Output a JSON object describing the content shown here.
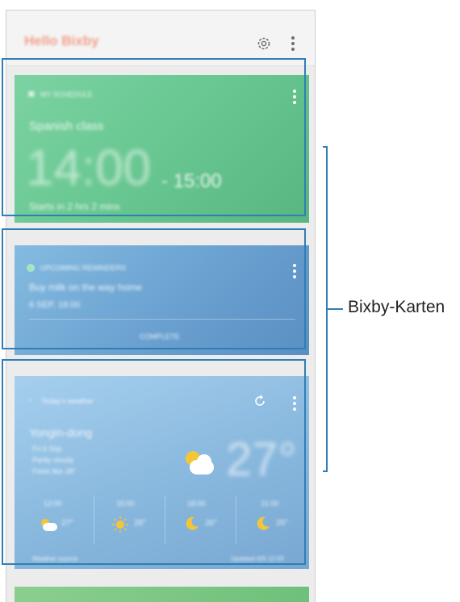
{
  "header": {
    "title": "Hello Bixby",
    "settings_icon": "gear-icon",
    "more_icon": "more-vertical-icon"
  },
  "cards": {
    "schedule": {
      "label": "MY SCHEDULE",
      "event": "Spanish class",
      "start_time": "14:00",
      "end_time": "- 15:00",
      "status": "Starts in 2 hrs 2 mins"
    },
    "reminder": {
      "label": "UPCOMING REMINDERS",
      "text": "Buy milk on the way home",
      "date": "6 SEP, 18:00",
      "action": "COMPLETE"
    },
    "weather": {
      "label": "Today's weather",
      "location": "Yongin-dong",
      "detail1": "Fri 6 Sep",
      "detail2": "Partly cloudy",
      "detail3": "Feels like 28°",
      "temperature": "27°",
      "forecast": [
        {
          "time": "12:00",
          "temp": "27°",
          "icon": "partly-cloudy-icon"
        },
        {
          "time": "15:00",
          "temp": "28°",
          "icon": "sun-icon"
        },
        {
          "time": "18:00",
          "temp": "26°",
          "icon": "moon-icon"
        },
        {
          "time": "21:00",
          "temp": "25°",
          "icon": "moon-icon"
        }
      ],
      "footer_left": "Weather source",
      "footer_right": "Updated 6/9 12:03"
    }
  },
  "annotation": {
    "label": "Bixby-Karten"
  },
  "colors": {
    "highlight": "#2f7fb4",
    "schedule_card": "#6ac892",
    "reminder_card": "#6ca3d2",
    "weather_card": "#8bbadf",
    "title_accent": "#f08a6c"
  }
}
